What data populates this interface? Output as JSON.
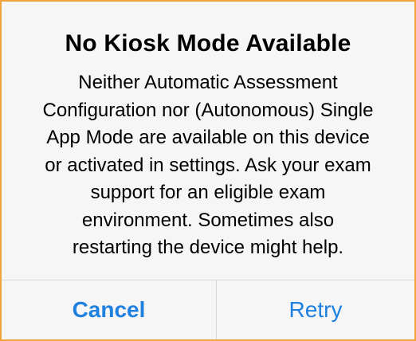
{
  "alert": {
    "title": "No Kiosk Mode Available",
    "message_lines": [
      "Neither Automatic Assessment",
      "Configuration nor (Autonomous) Single",
      "App Mode are available on this device",
      "or activated in settings. Ask your exam",
      "support for an eligible exam",
      "environment. Sometimes also",
      "restarting the device might help."
    ],
    "buttons": {
      "cancel": "Cancel",
      "retry": "Retry"
    }
  },
  "colors": {
    "accent": "#1f80e0",
    "frame_border": "#f2a33a",
    "background": "#f6f6f6"
  }
}
